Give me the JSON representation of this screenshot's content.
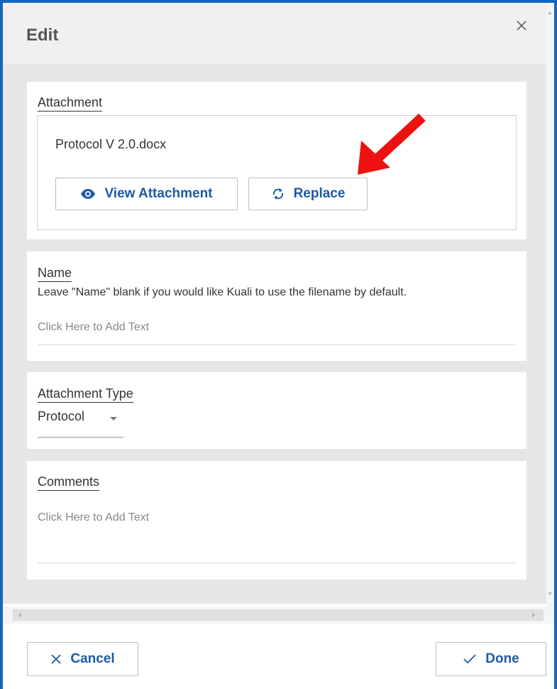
{
  "dialog": {
    "title": "Edit",
    "close_icon": "close-icon"
  },
  "attachment": {
    "label": "Attachment",
    "filename": "Protocol V 2.0.docx",
    "view_button": {
      "label": "View Attachment",
      "icon": "eye-icon"
    },
    "replace_button": {
      "label": "Replace",
      "icon": "refresh-icon"
    }
  },
  "name": {
    "label": "Name",
    "help": "Leave \"Name\" blank if you would like Kuali to use the filename by default.",
    "placeholder": "Click Here to Add Text"
  },
  "attachment_type": {
    "label": "Attachment Type",
    "selected": "Protocol"
  },
  "comments": {
    "label": "Comments",
    "placeholder": "Click Here to Add Text"
  },
  "footer": {
    "cancel_label": "Cancel",
    "done_label": "Done"
  },
  "annotation": {
    "arrow_color": "#ee1111"
  },
  "colors": {
    "accent": "#1e5aa8",
    "frame": "#1565c0"
  }
}
